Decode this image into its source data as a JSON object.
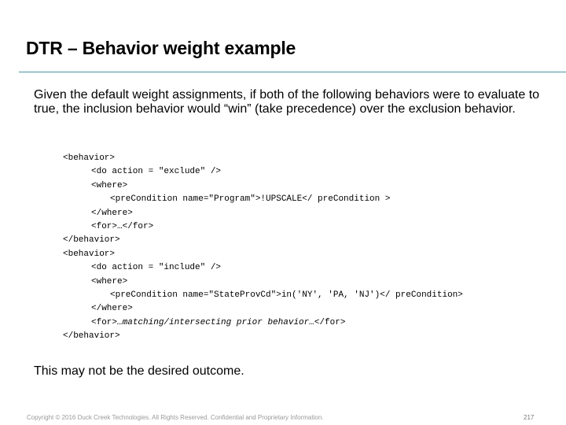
{
  "title": "DTR – Behavior weight example",
  "intro": "Given the default weight assignments, if both of the following behaviors were to evaluate to true, the inclusion behavior would “win” (take precedence) over the exclusion behavior.",
  "code": [
    "<behavior>",
    "<do action = \"exclude\" />",
    "<where>",
    "<preCondition name=\"Program\">!UPSCALE</ preCondition >",
    "</where>",
    "<for>…</for>",
    "</behavior>",
    "<behavior>",
    "<do action = \"include\" />",
    "<where>",
    "<preCondition name=\"StateProvCd\">in('NY', 'PA, 'NJ')</ preCondition>",
    "</where>",
    {
      "pre": "<for>",
      "italic": "…matching/intersecting prior behavior…",
      "post": "</for>"
    },
    "</behavior>"
  ],
  "outro": "This may not be the desired outcome.",
  "footer": "Copyright © 2016 Duck Creek Technologies. All Rights Reserved. Confidential and Proprietary Information.",
  "page_number": "217",
  "colors": {
    "rule": "#4b93a3"
  }
}
